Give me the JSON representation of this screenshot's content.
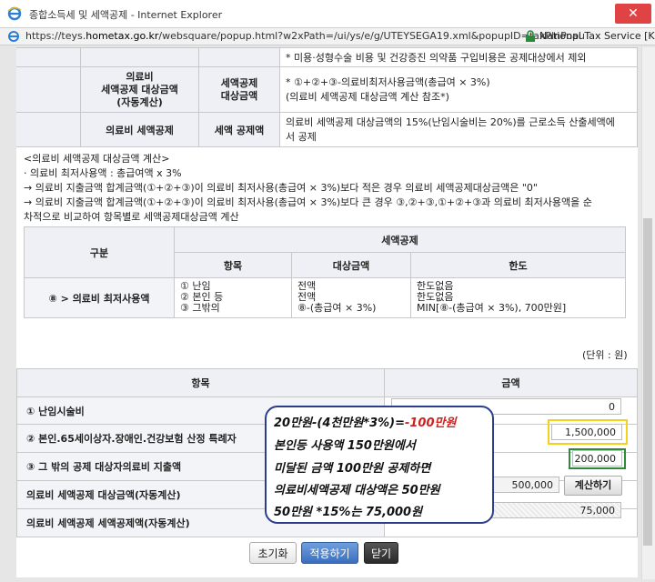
{
  "window": {
    "title": "종합소득세 및 세액공제 - Internet Explorer",
    "url_prefix": "https://teys.",
    "url_domain": "hometax.go.kr",
    "url_rest": "/websquare/popup.html?w2xPath=/ui/ys/e/g/UTEYSEGA19.xml&popupID=taxPlnPopu",
    "site_name": "National Tax Service [KR]",
    "close_label": "✕"
  },
  "top_table": {
    "row0_text": "* 미용·성형수술 비용 및 건강증진 의약품 구입비용은 공제대상에서 제외",
    "row1_label": "의료비\n세액공제 대상금액\n(자동계산)",
    "row1_sub": "세액공제\n대상금액",
    "row1_text": "* ①+②+③-의료비최저사용금액(총급여 × 3%)\n(의료비 세액공제 대상금액 계산 참조*)",
    "row2_label": "의료비 세액공제",
    "row2_sub": "세액 공제액",
    "row2_text": "의료비 세액공제 대상금액의 15%(난임시술비는 20%)를 근로소득 산출세액에\n서 공제"
  },
  "notes": [
    "<의료비 세액공제 대상금액 계산>",
    "· 의료비 최저사용액 : 총급여액 x 3%",
    "→ 의료비 지출금액 합계금액(①+②+③)이 의료비 최저사용(총급여 × 3%)보다 적은 경우 의료비 세액공제대상금액은 \"0\"",
    "→ 의료비 지출금액 합계금액(①+②+③)이 의료비 최저사용(총급여 × 3%)보다 큰 경우 ③,②+③,①+②+③과 의료비 최저사용액을 순",
    "차적으로 비교하여 항목별로 세액공제대상금액 계산"
  ],
  "calc_table": {
    "h_category": "구분",
    "h_deduction": "세액공제",
    "h_item": "항목",
    "h_target": "대상금액",
    "h_limit": "한도",
    "row_label": "⑧ > 의료비 최저사용액",
    "items": "① 난임\n② 본인 등\n③ 그밖의",
    "targets": "전액\n전액\n⑧-(총급여 × 3%)",
    "limits": "한도없음\n한도없음\nMIN[⑧-(총급여 × 3%), 700만원]"
  },
  "unit_label": "(단위 : 원)",
  "form": {
    "h_item": "항목",
    "h_amount": "금액",
    "rows": [
      {
        "label": "① 난임시술비",
        "value": "0"
      },
      {
        "label": "② 본인.65세이상자.장애인.건강보험 산정 특례자",
        "value": "1,500,000"
      },
      {
        "label": "③ 그 밖의 공제 대상자의료비 지출액",
        "value": "200,000"
      },
      {
        "label": "의료비 세액공제 대상금액(자동계산)",
        "value": "500,000"
      },
      {
        "label": "의료비 세액공제 세액공제액(자동계산)",
        "value": "75,000"
      }
    ],
    "calc_button": "계산하기"
  },
  "annotation": {
    "line1_a": "20만원-(4천만원*3%)=",
    "line1_b": "-100만원",
    "line2": "본인등 사용액 150만원에서",
    "line3": "미달된 금액 100만원 공제하면",
    "line4": "의료비세액공제 대상액은 50만원",
    "line5": "50만원 *15%는 75,000원"
  },
  "buttons": {
    "reset": "초기화",
    "apply": "적용하기",
    "close": "닫기"
  },
  "colors": {
    "highlight_yellow": "#f2d21b",
    "highlight_green": "#2e8b3a",
    "annotation_border": "#2a3e8c",
    "annotation_red": "#d12020"
  }
}
